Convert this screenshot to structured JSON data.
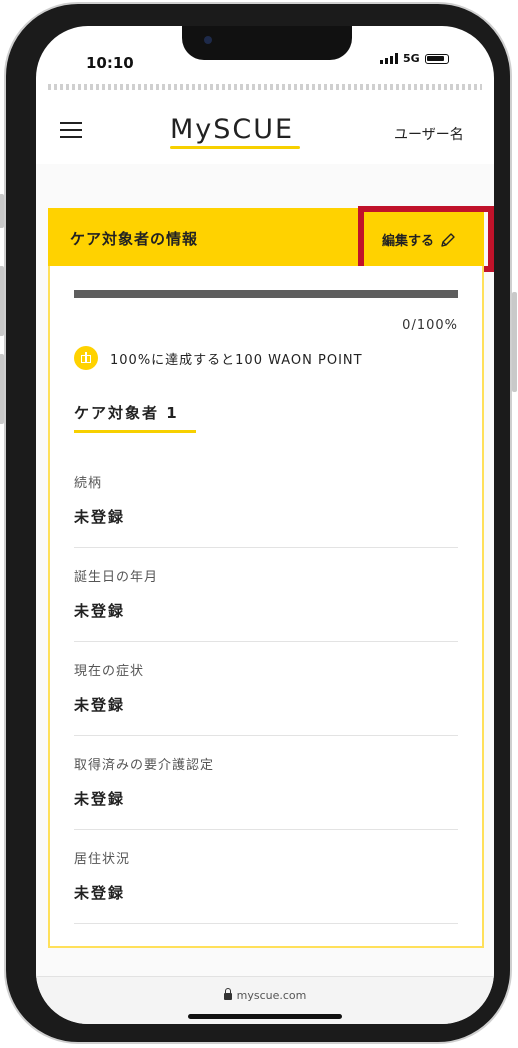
{
  "status_bar": {
    "time": "10:10",
    "network": "5G"
  },
  "header": {
    "logo": "MySCUE",
    "user_name": "ユーザー名"
  },
  "card": {
    "title": "ケア対象者の情報",
    "edit_label": "編集する",
    "progress_text": "0/100%",
    "progress_value": 0,
    "reward_text": "100%に達成すると100 WAON POINT",
    "person_title": "ケア対象者 1",
    "fields": [
      {
        "label": "続柄",
        "value": "未登録"
      },
      {
        "label": "誕生日の年月",
        "value": "未登録"
      },
      {
        "label": "現在の症状",
        "value": "未登録"
      },
      {
        "label": "取得済みの要介護認定",
        "value": "未登録"
      },
      {
        "label": "居住状況",
        "value": "未登録"
      }
    ]
  },
  "browser": {
    "url": "myscue.com"
  },
  "colors": {
    "accent": "#ffd200",
    "highlight": "#c0122a"
  }
}
